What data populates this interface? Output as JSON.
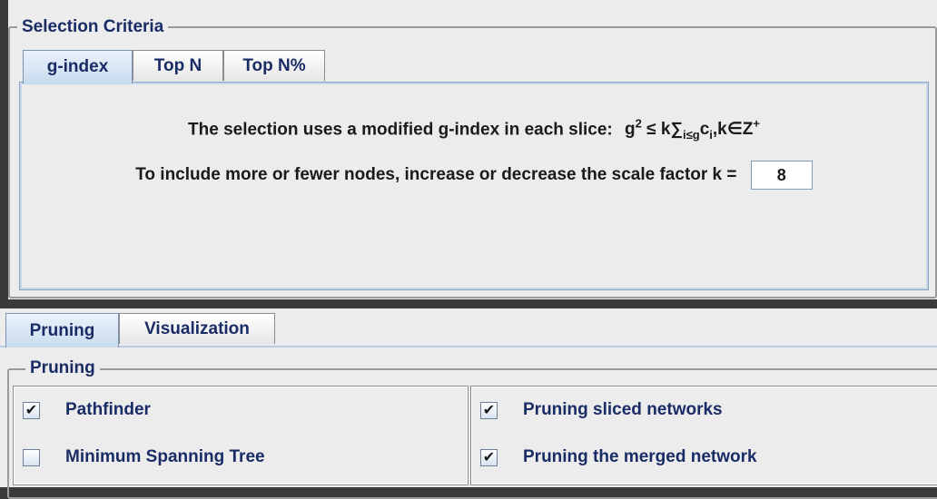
{
  "selection_criteria": {
    "title": "Selection Criteria",
    "tabs": [
      {
        "label": "g-index",
        "active": true
      },
      {
        "label": "Top N",
        "active": false
      },
      {
        "label": "Top N%",
        "active": false
      }
    ],
    "description": "The selection uses a modified g-index in each slice:",
    "formula": {
      "g": "g",
      "g_sup": "2",
      "leq_k_sum": "≤ k∑",
      "sum_sub": "i≤g",
      "c": "c",
      "c_sub": "i",
      "k_in_z": ",k∈Z",
      "z_sup": "+"
    },
    "scale_label": "To include more or fewer nodes, increase or decrease the scale factor k =",
    "scale_value": "8"
  },
  "bottom_tabs": [
    {
      "label": "Pruning",
      "active": true
    },
    {
      "label": "Visualization",
      "active": false
    }
  ],
  "pruning": {
    "title": "Pruning",
    "left": [
      {
        "label": "Pathfinder",
        "checked": true
      },
      {
        "label": "Minimum Spanning Tree",
        "checked": false
      }
    ],
    "right": [
      {
        "label": "Pruning sliced networks",
        "checked": true
      },
      {
        "label": "Pruning the merged network",
        "checked": true
      }
    ]
  },
  "icons": {
    "check": "checkmark-icon"
  },
  "colors": {
    "panel": "#ececec",
    "tab_active": "#c9dbef",
    "label": "#1a2c66",
    "border": "#8ba3c2"
  }
}
